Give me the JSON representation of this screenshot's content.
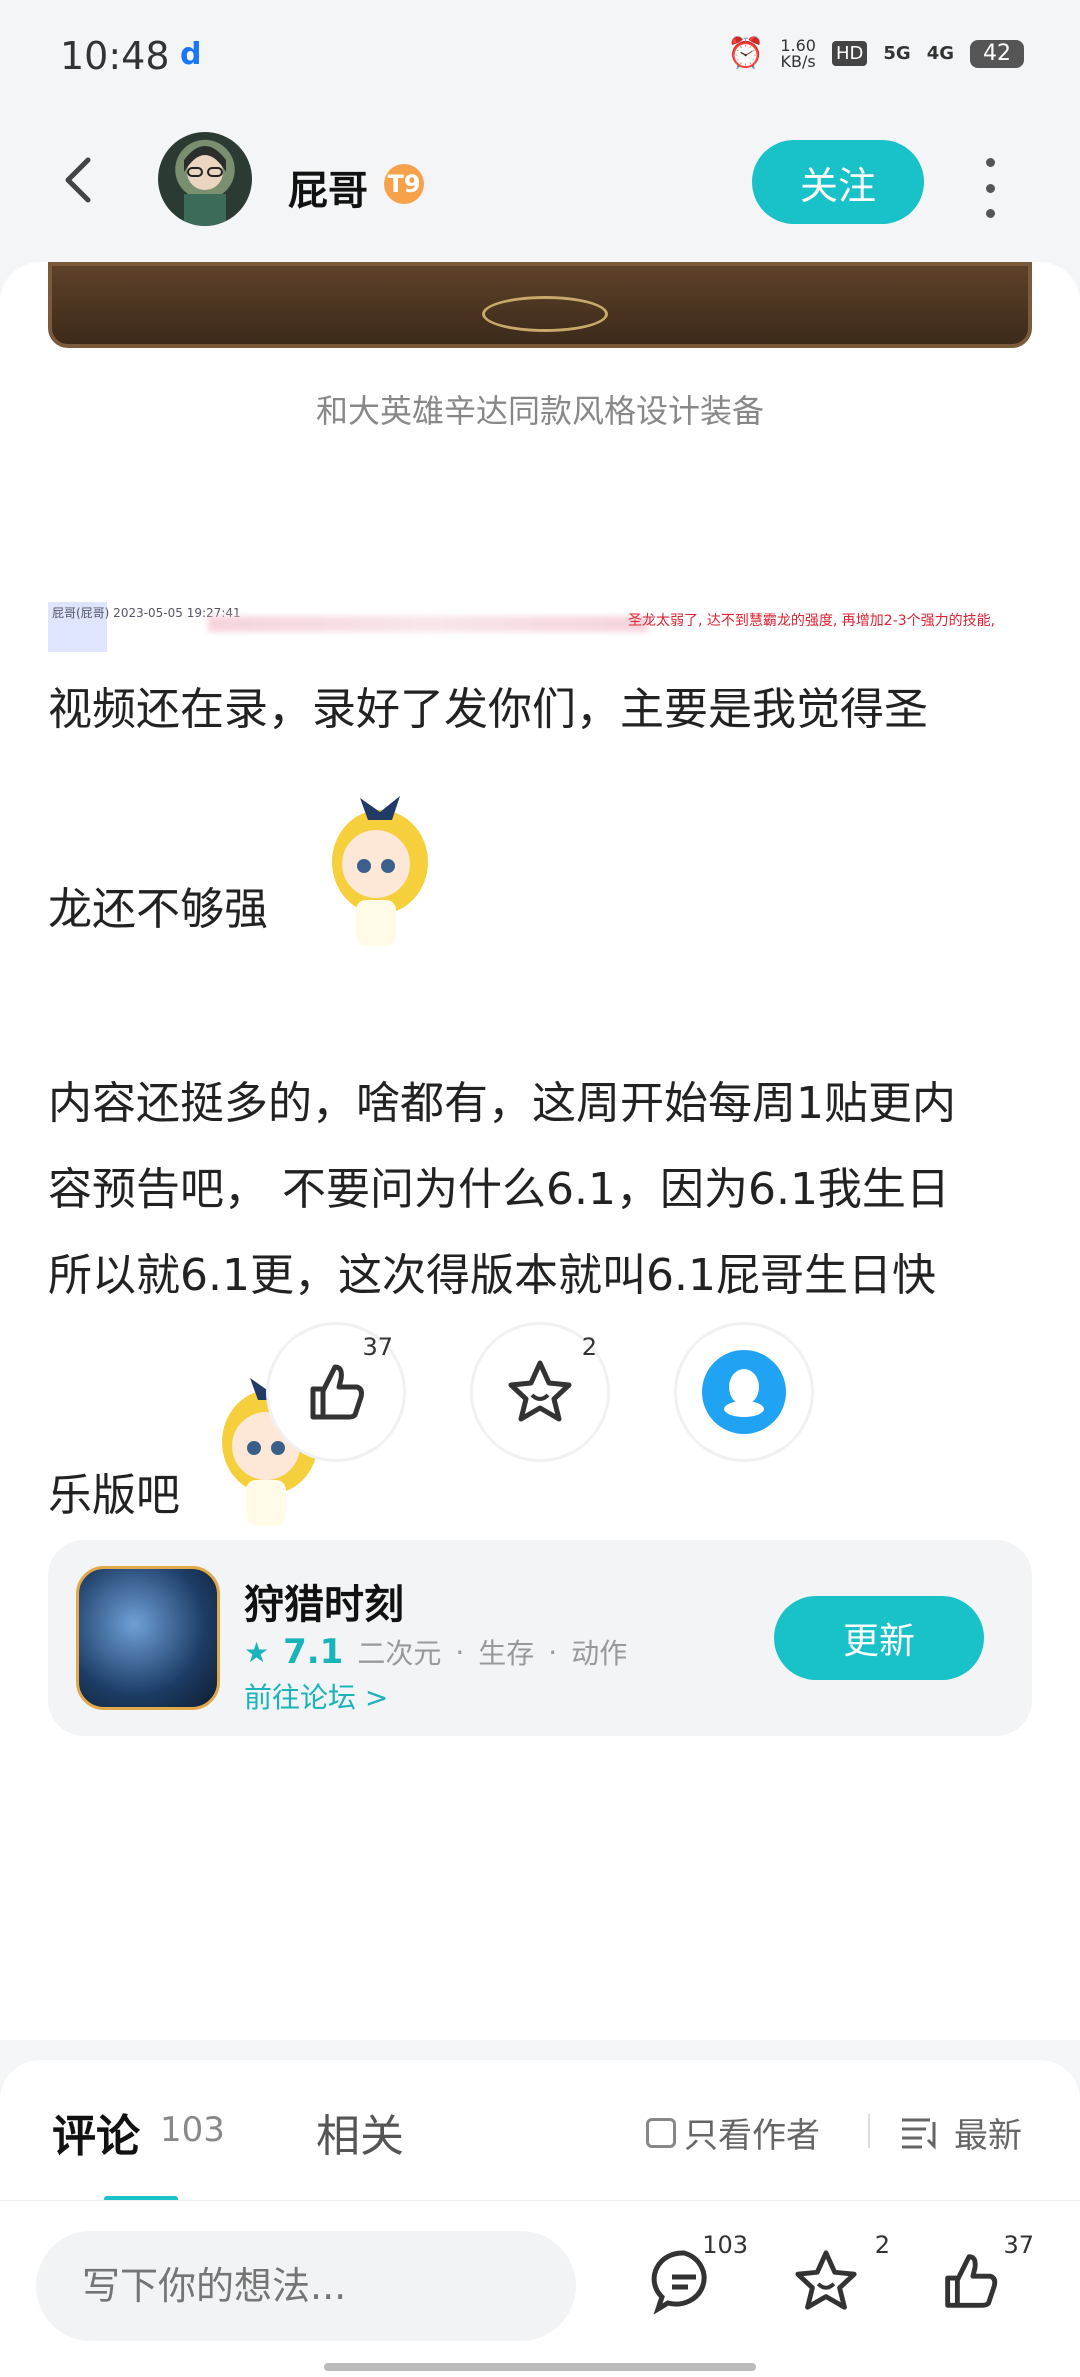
{
  "status_bar": {
    "time": "10:48",
    "net_speed": "1.60",
    "net_unit": "KB/s",
    "hd": "HD",
    "sig1": "5G",
    "sig2": "4G",
    "battery": "42"
  },
  "nav": {
    "username": "屁哥",
    "level": "T9",
    "follow_label": "关注"
  },
  "post": {
    "image_caption": "和大英雄辛达同款风格设计装备",
    "log_line1": "屁哥(屁哥) 2023-05-05 19:27:41",
    "log_red": "圣龙太弱了, 达不到慧霸龙的强度, 再增加2-3个强力的技能,",
    "para1": "视频还在录，录好了发你们，主要是我觉得圣",
    "para2": "龙还不够强",
    "para3_line1": "内容还挺多的，啥都有，这周开始每周1贴更内",
    "para3_line2": "容预告吧， 不要问为什么6.1，因为6.1我生日",
    "para3_line3": "所以就6.1更，这次得版本就叫6.1屁哥生日快",
    "para4": "乐版吧"
  },
  "actions": {
    "like_count": "37",
    "star_count": "2"
  },
  "game": {
    "name": "狩猎时刻",
    "score": "7.1",
    "tags": [
      "二次元",
      "生存",
      "动作"
    ],
    "forum_link": "前往论坛 >",
    "update_label": "更新"
  },
  "comments": {
    "tab_comment": "评论",
    "comment_count": "103",
    "tab_related": "相关",
    "only_author": "只看作者",
    "sort": "最新"
  },
  "bottom": {
    "placeholder": "写下你的想法...",
    "comment_count": "103",
    "star_count": "2",
    "like_count": "37"
  },
  "colors": {
    "accent": "#19c1c8",
    "qq": "#1fa3f2",
    "level": "#f7a14a"
  }
}
